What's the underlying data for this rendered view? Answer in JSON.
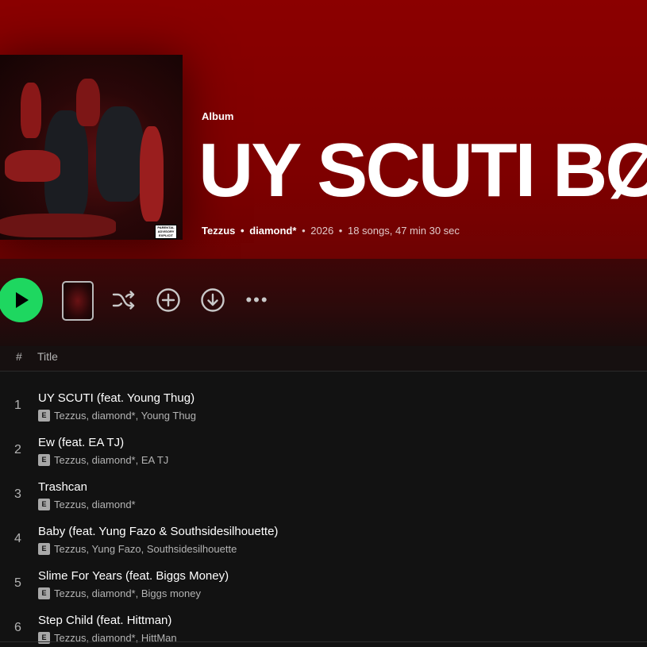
{
  "album": {
    "type_label": "Album",
    "title": "UY SCUTI BØ",
    "artist_1": "Tezzus",
    "artist_2": "diamond*",
    "year": "2026",
    "summary": "18 songs, 47 min 30 sec",
    "cover_advisory_text": "PARENTAL ADVISORY EXPLICIT CONTENT"
  },
  "actions": {
    "play_icon": "play-icon",
    "shuffle_icon": "shuffle-icon",
    "add_icon": "add-circle-icon",
    "download_icon": "download-circle-icon",
    "more_label": "•••"
  },
  "table": {
    "num_header": "#",
    "title_header": "Title"
  },
  "tracks": [
    {
      "num": "1",
      "name": "UY SCUTI (feat. Young Thug)",
      "explicit": "E",
      "artists": "Tezzus, diamond*, Young Thug"
    },
    {
      "num": "2",
      "name": "Ew (feat. EA TJ)",
      "explicit": "E",
      "artists": "Tezzus, diamond*, EA TJ"
    },
    {
      "num": "3",
      "name": "Trashcan",
      "explicit": "E",
      "artists": "Tezzus, diamond*"
    },
    {
      "num": "4",
      "name": "Baby (feat. Yung Fazo & Southsidesilhouette)",
      "explicit": "E",
      "artists": "Tezzus, Yung Fazo, Southsidesilhouette"
    },
    {
      "num": "5",
      "name": "Slime For Years (feat. Biggs Money)",
      "explicit": "E",
      "artists": "Tezzus, diamond*, Biggs money"
    },
    {
      "num": "6",
      "name": "Step Child (feat. Hittman)",
      "explicit": "E",
      "artists": "Tezzus, diamond*, HittMan"
    }
  ],
  "colors": {
    "header_red": "#8b0000",
    "play_green": "#1ed760",
    "background": "#121212",
    "secondary_text": "#b3b3b3"
  }
}
